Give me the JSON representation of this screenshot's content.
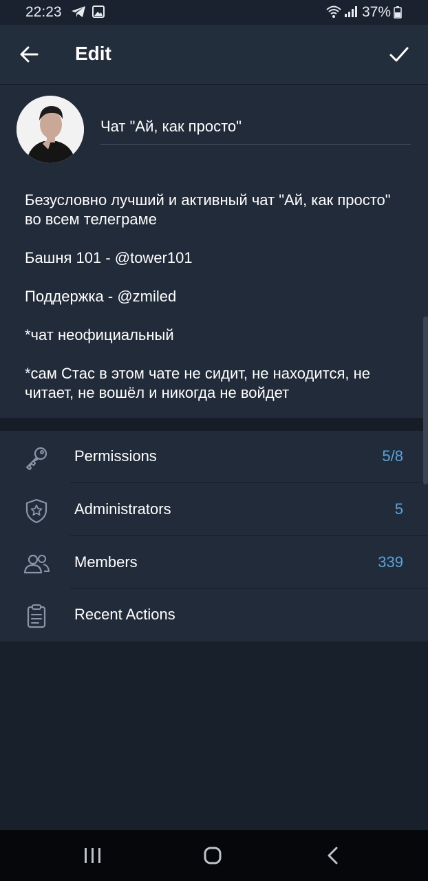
{
  "status_bar": {
    "time": "22:23",
    "battery": "37%",
    "icons": [
      "telegram-icon",
      "image-icon",
      "wifi-icon",
      "signal-icon",
      "battery-icon"
    ]
  },
  "app_bar": {
    "title": "Edit",
    "back_icon": "arrow-left-icon",
    "done_icon": "checkmark-icon"
  },
  "profile": {
    "chat_name": "Чат \"Ай, как просто\"",
    "description": [
      "Безусловно лучший и активный чат \"Ай, как просто\" во всем телеграме",
      "Башня 101 - @tower101",
      "Поддержка - @zmiled",
      "*чат неофициальный",
      "*сам Стас в этом чате не сидит, не находится, не читает, не вошёл и никогда не войдет"
    ]
  },
  "menu": {
    "items": [
      {
        "label": "Permissions",
        "value": "5/8",
        "icon": "key-icon"
      },
      {
        "label": "Administrators",
        "value": "5",
        "icon": "shield-star-icon"
      },
      {
        "label": "Members",
        "value": "339",
        "icon": "people-icon"
      },
      {
        "label": "Recent Actions",
        "value": "",
        "icon": "clipboard-icon"
      }
    ]
  },
  "colors": {
    "background": "#18202b",
    "panel": "#212b3a",
    "app_bar": "#232e3d",
    "accent_value": "#5aa4dc",
    "icon": "#8a96a6"
  },
  "nav_bar": {
    "icons": [
      "recent-apps-icon",
      "home-icon",
      "back-icon"
    ]
  }
}
